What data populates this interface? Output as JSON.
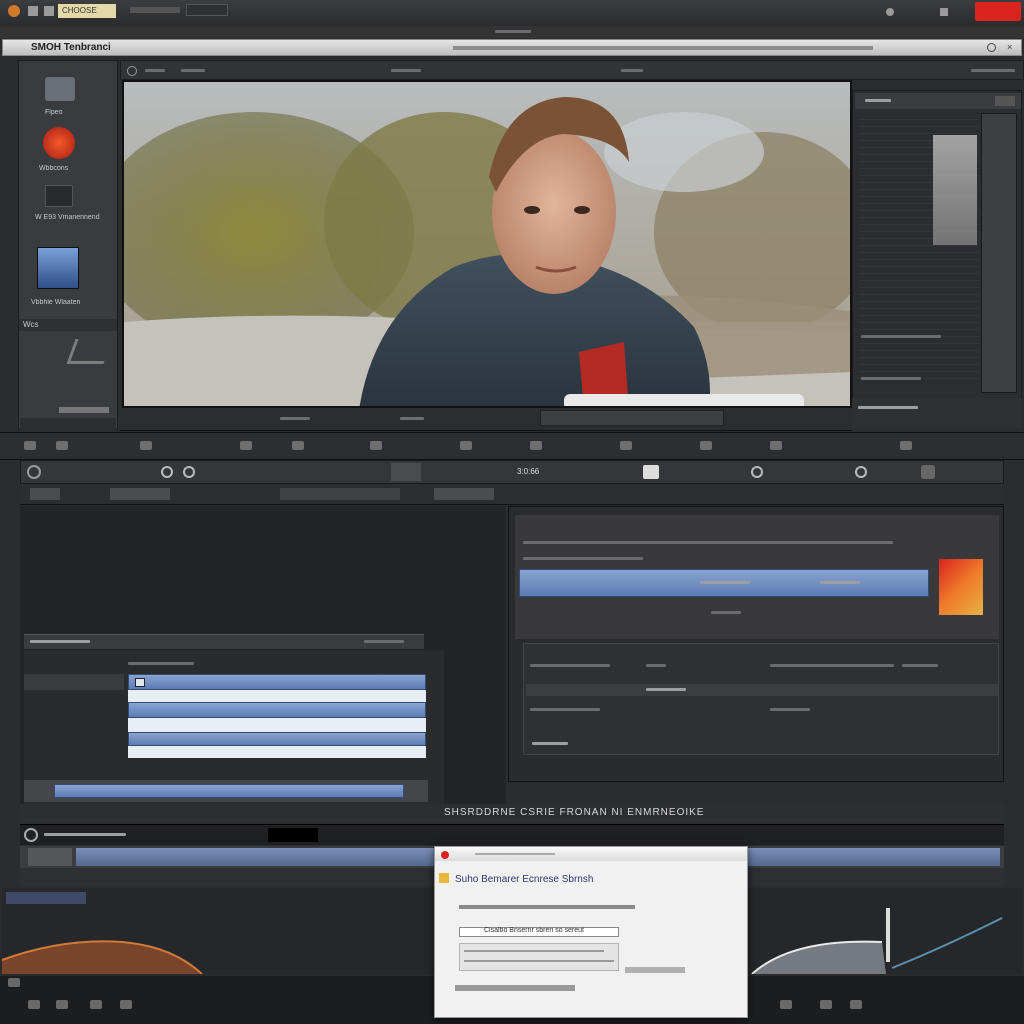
{
  "app": {
    "window_title": "SMOH Tenbranci",
    "tab_label": "CHOOSE"
  },
  "sidebar": {
    "items": [
      {
        "label": "Flpeo"
      },
      {
        "label": "Wbbcons"
      },
      {
        "label": "W E93 Vmanennend"
      },
      {
        "label": "Vbbhle Wlaaten"
      }
    ],
    "section_label": "Wcs"
  },
  "timeline": {
    "timecode": "3:0:66",
    "status_text": "SHSRDDRNE CSRIE FRONAN NI ENMRNEOIKE"
  },
  "dialog": {
    "title": "Suho Bemarer Ecnrese Sbrnsh",
    "field_label": "Clsalbo Bnsernr sbreri so sereut"
  },
  "colors": {
    "accent_red": "#d8231f",
    "selection_blue": "#6f8ec6"
  }
}
